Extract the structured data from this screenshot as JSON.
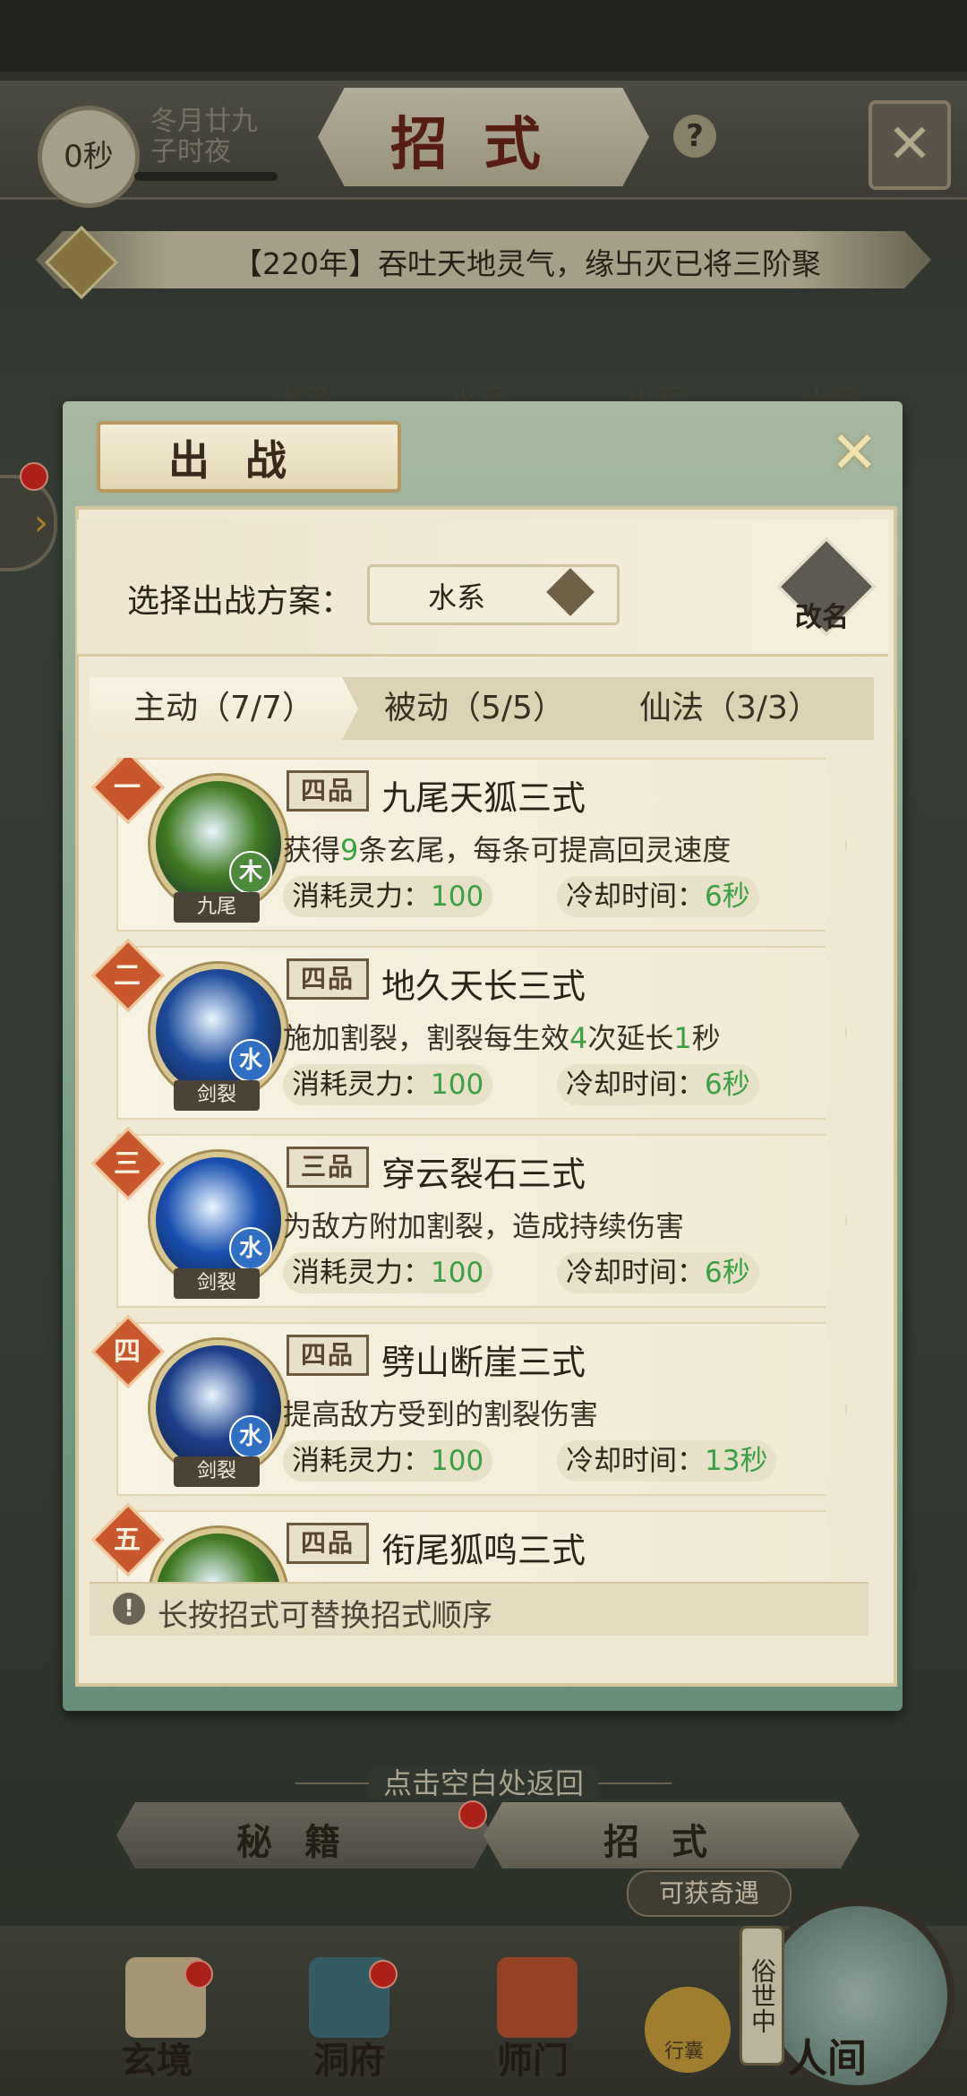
{
  "status": {
    "timer": "0秒",
    "date_line1": "冬月廿九",
    "date_line2": "子时夜"
  },
  "header": {
    "title": "招式",
    "help": "?",
    "close": "✕"
  },
  "notice": {
    "text": "【220年】吞吐天地灵气，缘卐灭已将三阶聚"
  },
  "background_tabs": [
    "木系",
    "水系",
    "火系",
    "土系"
  ],
  "modal": {
    "title": "出战",
    "close": "✕",
    "plan_label": "选择出战方案：",
    "plan_value": "水系",
    "rename_label": "改名",
    "tabs": [
      {
        "label": "主动（7/7）",
        "active": true
      },
      {
        "label": "被动（5/5）",
        "active": false
      },
      {
        "label": "仙法（3/3）",
        "active": false
      }
    ],
    "skills": [
      {
        "rank": "一",
        "grade": "四品",
        "name": "九尾天狐三式",
        "desc_parts": [
          "获得",
          "9",
          "条玄尾，每条可提高回灵速度"
        ],
        "cost_label": "消耗灵力：",
        "cost": "100",
        "cd_label": "冷却时间：",
        "cd": "6秒",
        "element": "木",
        "element_color": "#4a8a3a",
        "tag": "九尾",
        "orb_color": "#3f7a22"
      },
      {
        "rank": "二",
        "grade": "四品",
        "name": "地久天长三式",
        "desc_parts": [
          "施加割裂，割裂每生效",
          "4",
          "次延长",
          "1",
          "秒"
        ],
        "cost_label": "消耗灵力：",
        "cost": "100",
        "cd_label": "冷却时间：",
        "cd": "6秒",
        "element": "水",
        "element_color": "#2f6fc4",
        "tag": "剑裂",
        "orb_color": "#1d4a9a"
      },
      {
        "rank": "三",
        "grade": "三品",
        "name": "穿云裂石三式",
        "desc_parts": [
          "为敌方附加割裂，造成持续伤害"
        ],
        "cost_label": "消耗灵力：",
        "cost": "100",
        "cd_label": "冷却时间：",
        "cd": "6秒",
        "element": "水",
        "element_color": "#2f6fc4",
        "tag": "剑裂",
        "orb_color": "#1a4fb0"
      },
      {
        "rank": "四",
        "grade": "四品",
        "name": "劈山断崖三式",
        "desc_parts": [
          "提高敌方受到的割裂伤害"
        ],
        "cost_label": "消耗灵力：",
        "cost": "100",
        "cd_label": "冷却时间：",
        "cd": "13秒",
        "element": "水",
        "element_color": "#2f6fc4",
        "tag": "剑裂",
        "orb_color": "#1b3f8a"
      },
      {
        "rank": "五",
        "grade": "四品",
        "name": "衔尾狐鸣三式",
        "desc_parts": [],
        "cost_label": "",
        "cost": "",
        "cd_label": "",
        "cd": "",
        "element": "",
        "element_color": "#4a8a3a",
        "tag": "",
        "orb_color": "#3f7a22"
      }
    ],
    "hint": "长按招式可替换招式顺序",
    "hint_icon": "!"
  },
  "bottom": {
    "return_hint": "点击空白处返回",
    "btn_secret": "秘籍",
    "btn_moves": "招式",
    "chance": "可获奇遇",
    "nav": [
      "玄境",
      "洞府",
      "师门"
    ],
    "bag_label": "行囊",
    "world_tag": "俗世中",
    "world_label": "人间"
  },
  "icons": {
    "notice": "lock-icon",
    "help": "question-icon",
    "modal_close": "close-icon",
    "plan_arrow": "chevron-down-icon",
    "rename": "quill-icon",
    "hint": "exclamation-icon"
  }
}
